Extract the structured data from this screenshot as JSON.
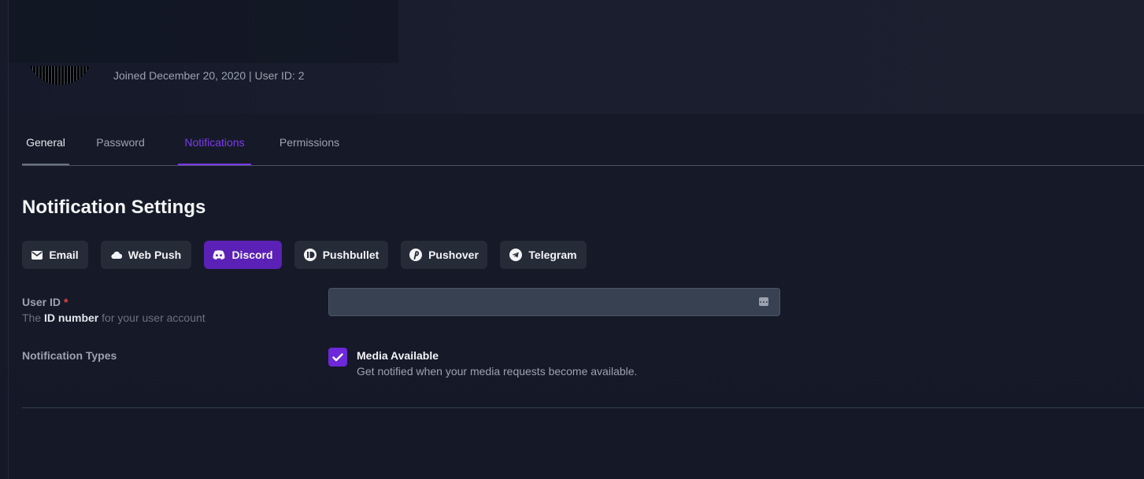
{
  "profile": {
    "joined_text": "Joined December 20, 2020 | User ID: 2"
  },
  "tabs": [
    {
      "label": "General",
      "state": "visited"
    },
    {
      "label": "Password",
      "state": "inactive"
    },
    {
      "label": "Notifications",
      "state": "active"
    },
    {
      "label": "Permissions",
      "state": "inactive"
    }
  ],
  "section": {
    "title": "Notification Settings"
  },
  "agents": [
    {
      "label": "Email",
      "icon": "mail-icon"
    },
    {
      "label": "Web Push",
      "icon": "cloud-icon"
    },
    {
      "label": "Discord",
      "icon": "discord-icon",
      "active": true
    },
    {
      "label": "Pushbullet",
      "icon": "pushbullet-icon"
    },
    {
      "label": "Pushover",
      "icon": "pushover-icon"
    },
    {
      "label": "Telegram",
      "icon": "telegram-icon"
    }
  ],
  "form": {
    "user_id": {
      "label": "User ID",
      "required_mark": "*",
      "help_prefix": "The",
      "help_strong": "ID number",
      "help_suffix": "for your user account",
      "value": "",
      "placeholder": ""
    },
    "notification_types": {
      "label": "Notification Types",
      "items": [
        {
          "title": "Media Available",
          "description": "Get notified when your media requests become available.",
          "checked": true
        }
      ]
    }
  },
  "colors": {
    "accent": "#7c3aed",
    "active_button": "#5b21b6",
    "button_bg": "#262b38",
    "page_bg": "#151927",
    "required": "#ef4444"
  }
}
